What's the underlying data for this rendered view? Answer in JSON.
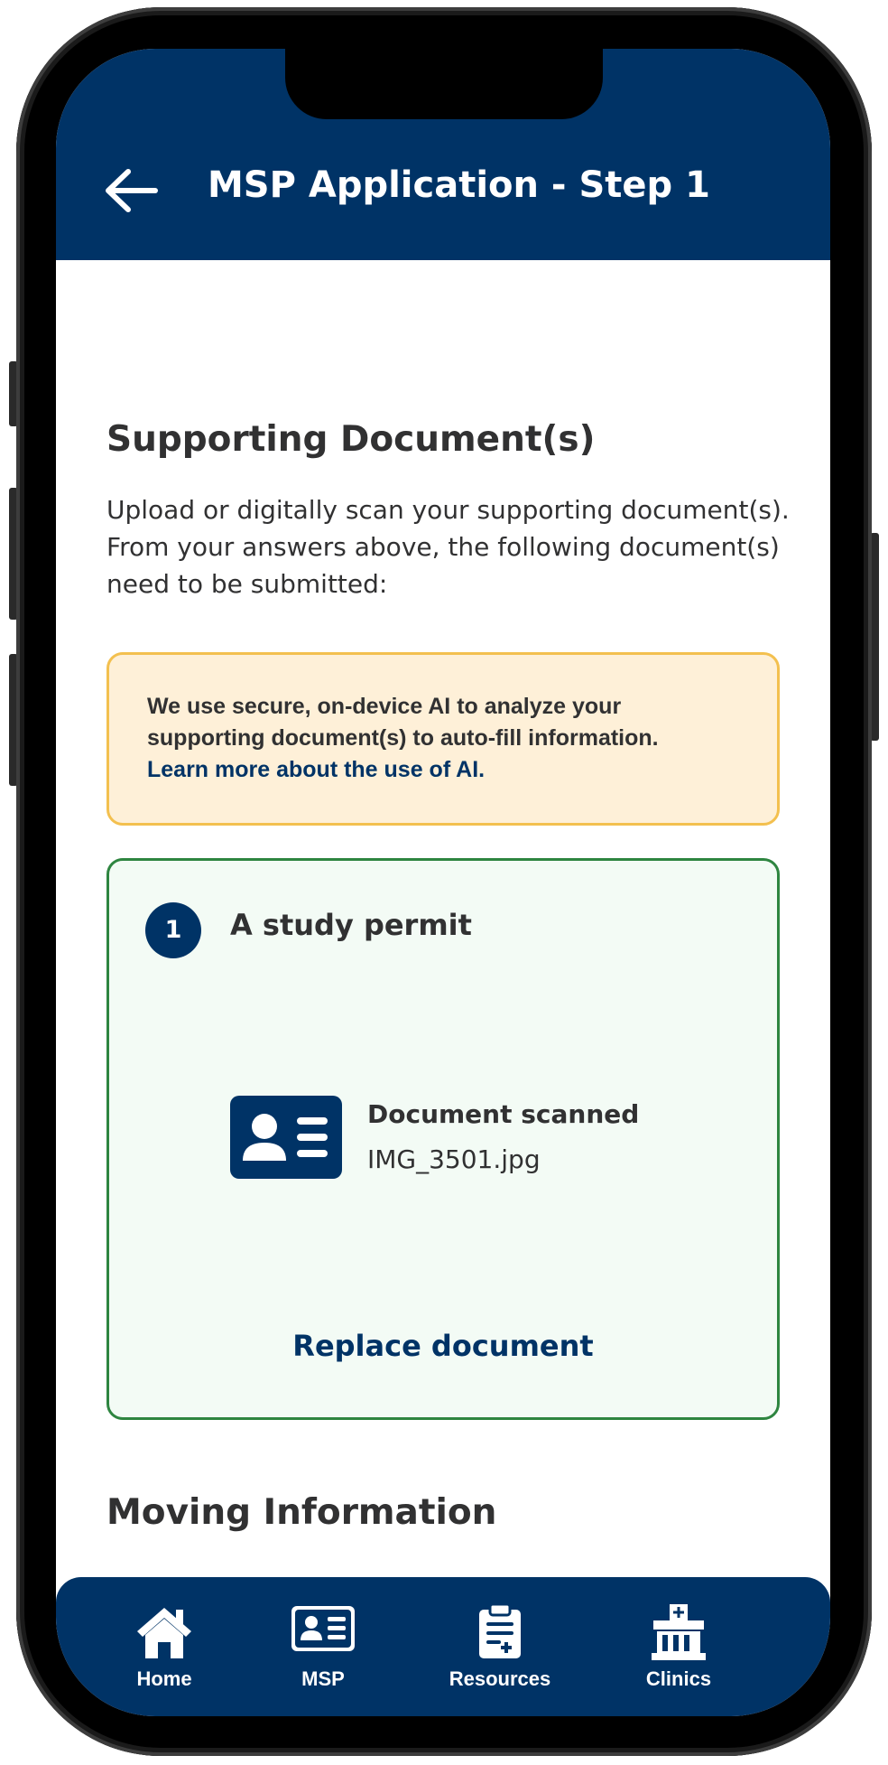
{
  "header": {
    "title": "MSP Application - Step 1",
    "back_icon": "arrow-left-icon"
  },
  "supporting_documents": {
    "title": "Supporting Document(s)",
    "description": "Upload or digitally scan your supporting document(s). From your answers above, the following document(s) need to be submitted:",
    "ai_notice": {
      "text": "We use secure, on-device AI to analyze your supporting document(s) to auto-fill information.",
      "link_label": "Learn more about the use of AI."
    },
    "document_card": {
      "step_number": "1",
      "document_name": "A study permit",
      "icon": "id-card-icon",
      "status": "Document scanned",
      "file_name": "IMG_3501.jpg",
      "replace_label": "Replace document"
    }
  },
  "moving_information": {
    "title": "Moving Information"
  },
  "bottom_nav": {
    "items": [
      {
        "label": "Home",
        "icon": "home-icon"
      },
      {
        "label": "MSP",
        "icon": "id-card-icon"
      },
      {
        "label": "Resources",
        "icon": "clipboard-icon"
      },
      {
        "label": "Clinics",
        "icon": "clinic-icon"
      }
    ]
  },
  "colors": {
    "primary": "#003366",
    "text": "#313132",
    "notice_bg": "#fef0d8",
    "notice_border": "#f3c04f",
    "success_bg": "#f3fbf5",
    "success_border": "#2e8540"
  }
}
